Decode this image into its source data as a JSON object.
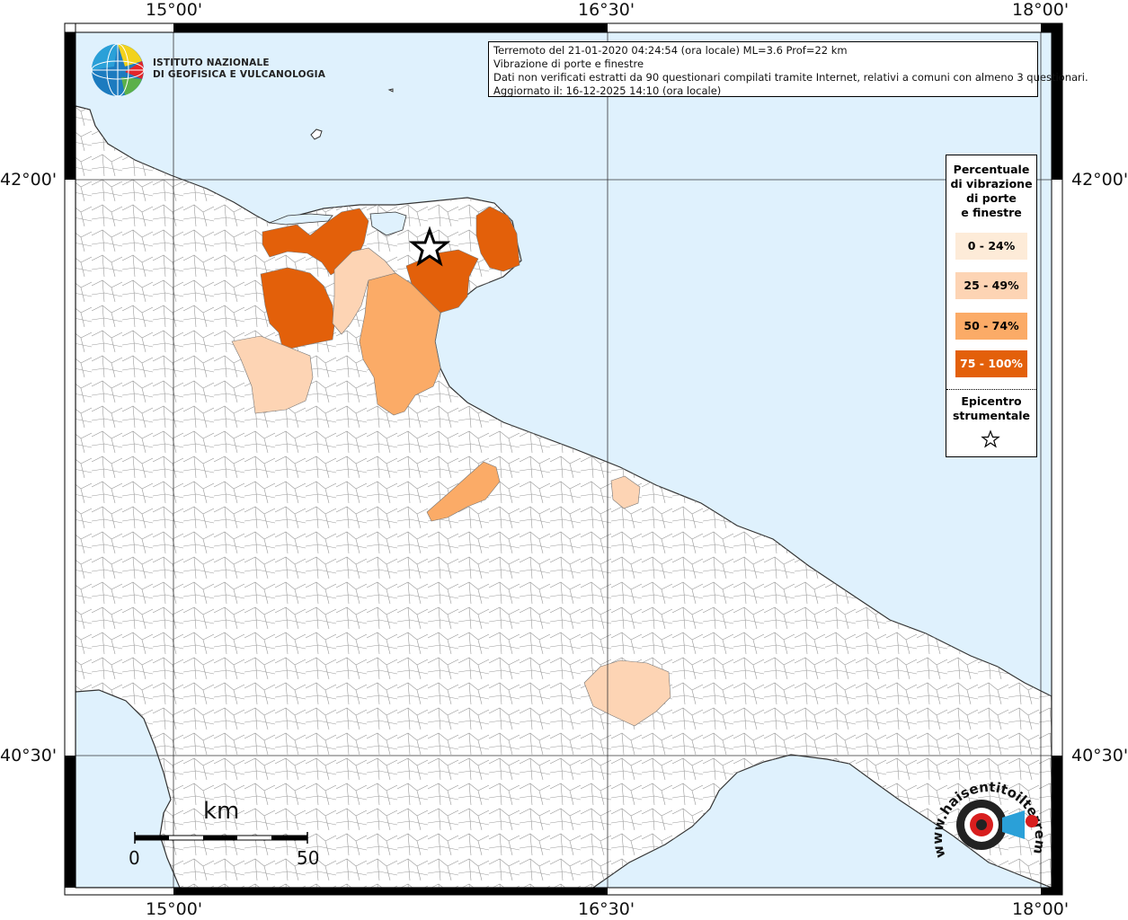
{
  "ticks": {
    "lon": [
      "15°00'",
      "16°30'",
      "18°00'"
    ],
    "lat": [
      "42°00'",
      "40°30'"
    ]
  },
  "info": {
    "line1": "Terremoto del 21-01-2020 04:24:54 (ora locale) ML=3.6 Prof=22 km",
    "line2": "Vibrazione di porte e finestre",
    "line3": "Dati non verificati estratti da 90 questionari compilati tramite Internet, relativi a comuni con almeno 3 questionari.",
    "line4": "Aggiornato il: 16-12-2025 14:10 (ora locale)"
  },
  "logo": {
    "line1": "ISTITUTO NAZIONALE",
    "line2": "DI GEOFISICA E VULCANOLOGIA"
  },
  "legend": {
    "title_lines": [
      "Percentuale",
      "di vibrazione",
      "di porte",
      "e finestre"
    ],
    "classes": [
      {
        "label": "0 - 24%",
        "color": "#fdebd8"
      },
      {
        "label": "25 - 49%",
        "color": "#fdd4b4"
      },
      {
        "label": "50 - 74%",
        "color": "#fbab67"
      },
      {
        "label": "75 - 100%",
        "color": "#e3600a"
      }
    ],
    "epicenter_lines": [
      "Epicentro",
      "strumentale"
    ]
  },
  "scale": {
    "unit": "km",
    "min": "0",
    "max": "50"
  },
  "watermark": {
    "text": "www.haisentitoilterremoto.it"
  },
  "colors": {
    "sea": "#dff1fd",
    "land": "#ffffff",
    "class_25_49": "#fdd4b4",
    "class_50_74": "#fbab67",
    "class_75_100": "#e3600a"
  }
}
